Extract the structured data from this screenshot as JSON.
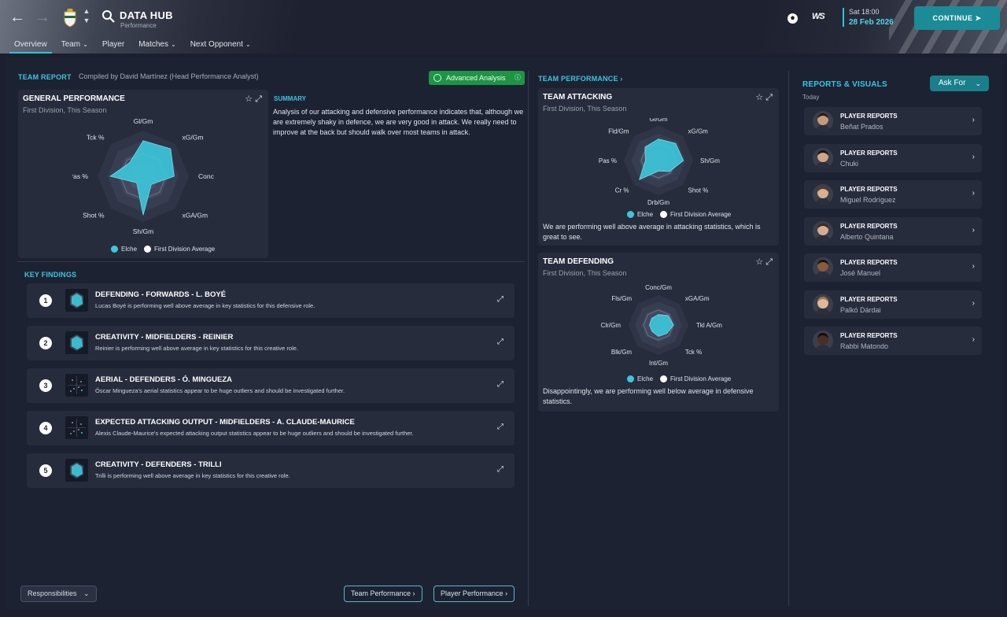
{
  "header": {
    "title": "DATA HUB",
    "subtitle": "Performance",
    "tabs": [
      {
        "label": "Overview",
        "active": true,
        "dropdown": false
      },
      {
        "label": "Team",
        "active": false,
        "dropdown": true
      },
      {
        "label": "Player",
        "active": false,
        "dropdown": false
      },
      {
        "label": "Matches",
        "active": false,
        "dropdown": true
      },
      {
        "label": "Next Opponent",
        "active": false,
        "dropdown": true
      }
    ],
    "date_day": "Sat 18:00",
    "date_full": "28 Feb 2026",
    "continue_label": "CONTINUE",
    "brand_badge": "WS"
  },
  "team_report": {
    "heading": "TEAM REPORT",
    "compiled_by": "Compiled by David Martínez (Head Performance Analyst)",
    "advanced_label": "Advanced Analysis",
    "general": {
      "title": "GENERAL PERFORMANCE",
      "subtitle": "First Division, This Season",
      "axes": [
        "Gl/Gm",
        "xG/Gm",
        "Conc/Gm",
        "xGA/Gm",
        "Sh/Gm",
        "Shot %",
        "Pas %",
        "Tck %"
      ],
      "team_values": [
        0.78,
        0.85,
        0.68,
        0.25,
        0.85,
        0.2,
        0.72,
        0.42
      ],
      "legend_team": "Elche",
      "legend_avg": "First Division Average"
    },
    "summary_heading": "SUMMARY",
    "summary_text": "Analysis of our attacking and defensive performance indicates that, although we are extremely shaky in defence, we are very good in attack. We really need to improve at the back but should walk over most teams in attack."
  },
  "key_findings": {
    "heading": "KEY FINDINGS",
    "items": [
      {
        "num": "1",
        "title": "DEFENDING - FORWARDS - L. BOYÉ",
        "desc": "Lucas Boyé is performing well above average in key statistics for this defensive role.",
        "thumb": "radar"
      },
      {
        "num": "2",
        "title": "CREATIVITY - MIDFIELDERS - REINIER",
        "desc": "Reinier is performing well above average in key statistics for this creative role.",
        "thumb": "radar"
      },
      {
        "num": "3",
        "title": "AERIAL - DEFENDERS - Ó. MINGUEZA",
        "desc": "Óscar Mingueza's aerial statistics appear to be huge outliers and should be investigated further.",
        "thumb": "scatter"
      },
      {
        "num": "4",
        "title": "EXPECTED ATTACKING OUTPUT - MIDFIELDERS - A. CLAUDE-MAURICE",
        "desc": "Alexis Claude-Maurice's expected attacking output statistics appear to be huge outliers and should be investigated further.",
        "thumb": "scatter"
      },
      {
        "num": "5",
        "title": "CREATIVITY - DEFENDERS - TRILLI",
        "desc": "Trilli is performing well above average in key statistics for this creative role.",
        "thumb": "radar"
      }
    ]
  },
  "team_performance": {
    "heading": "TEAM PERFORMANCE",
    "attacking": {
      "title": "TEAM ATTACKING",
      "subtitle": "First Division, This Season",
      "axes": [
        "Gl/Gm",
        "xG/Gm",
        "Sh/Gm",
        "Shot %",
        "Drb/Gm",
        "Cr %",
        "Pas %",
        "Fld/Gm"
      ],
      "team_values": [
        0.62,
        0.7,
        0.72,
        0.45,
        0.3,
        0.78,
        0.38,
        0.55
      ],
      "legend_team": "Elche",
      "legend_avg": "First Division Average",
      "text": "We are performing well above average in attacking statistics, which is great to see."
    },
    "defending": {
      "title": "TEAM DEFENDING",
      "subtitle": "First Division, This Season",
      "axes": [
        "Conc/Gm",
        "xGA/Gm",
        "Tkl A/Gm",
        "Tck %",
        "Int/Gm",
        "Blk/Gm",
        "Clr/Gm",
        "Fls/Gm"
      ],
      "team_values": [
        0.35,
        0.45,
        0.5,
        0.4,
        0.38,
        0.3,
        0.3,
        0.32
      ],
      "legend_team": "Elche",
      "legend_avg": "First Division Average",
      "text": "Disappointingly, we are performing well below average in defensive statistics."
    }
  },
  "reports": {
    "heading": "REPORTS & VISUALS",
    "ask_for": "Ask For",
    "when": "Today",
    "items": [
      {
        "type": "PLAYER REPORTS",
        "name": "Beñat Prados",
        "skin": "#c89a7a",
        "hair": "#2a1d16"
      },
      {
        "type": "PLAYER REPORTS",
        "name": "Chuki",
        "skin": "#d0a588",
        "hair": "#1e1510"
      },
      {
        "type": "PLAYER REPORTS",
        "name": "Miguel Rodríguez",
        "skin": "#d9b08e",
        "hair": "#5a3a22"
      },
      {
        "type": "PLAYER REPORTS",
        "name": "Alberto Quintana",
        "skin": "#d7ad90",
        "hair": "#3a2a20"
      },
      {
        "type": "PLAYER REPORTS",
        "name": "José Manuel",
        "skin": "#8a5a3c",
        "hair": "#1a1210"
      },
      {
        "type": "PLAYER REPORTS",
        "name": "Palkó Dárdai",
        "skin": "#e0b898",
        "hair": "#9b7a52"
      },
      {
        "type": "PLAYER REPORTS",
        "name": "Rabbi Matondo",
        "skin": "#4a2e20",
        "hair": "#120c0a"
      }
    ]
  },
  "footer": {
    "responsibilities": "Responsibilities",
    "team_perf_btn": "Team Performance",
    "player_perf_btn": "Player Performance"
  },
  "colors": {
    "accent": "#39c6e0",
    "team_fill": "#3cc7dc",
    "continue": "#1b8b97",
    "advanced": "#1e9445"
  }
}
